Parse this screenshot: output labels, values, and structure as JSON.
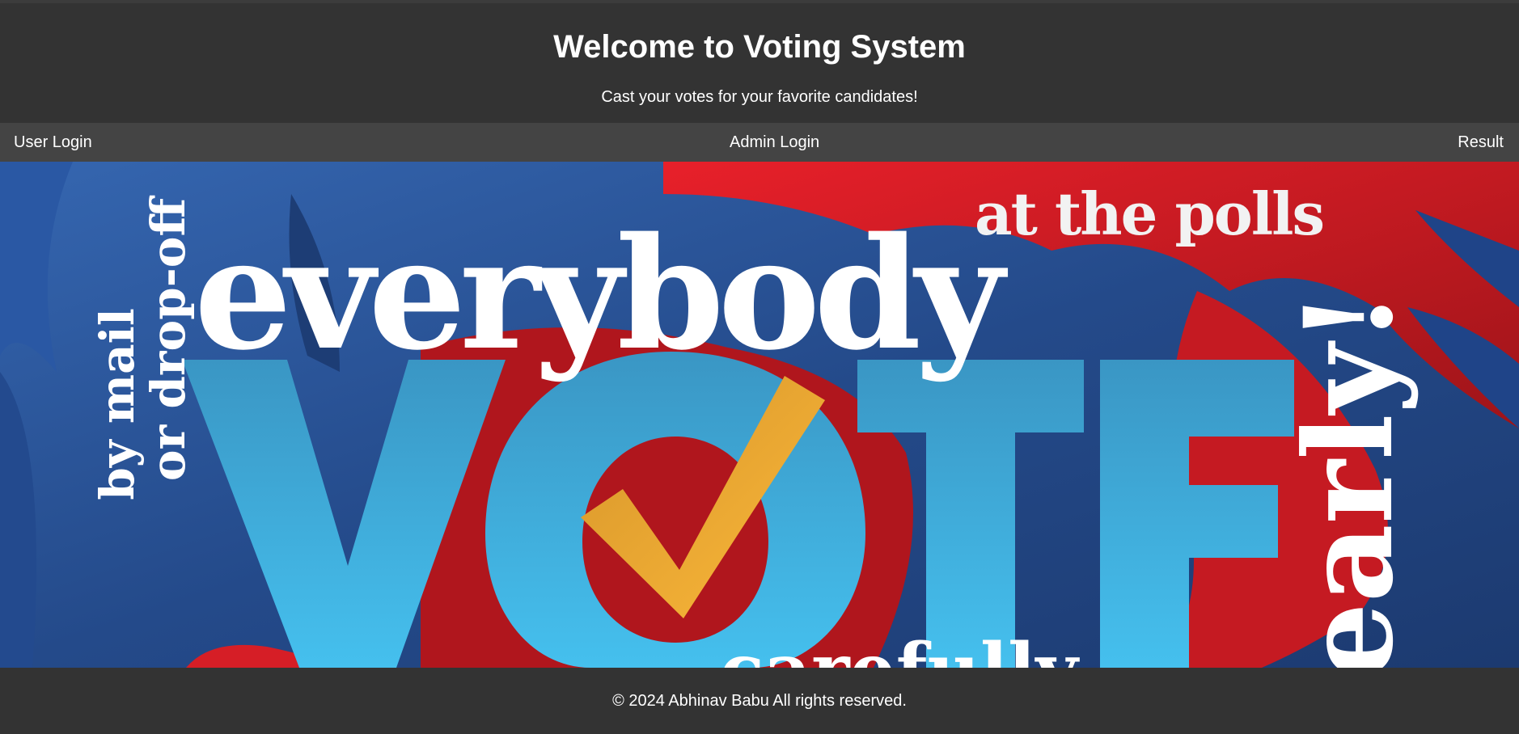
{
  "header": {
    "title": "Welcome to Voting System",
    "subtitle": "Cast your votes for your favorite candidates!"
  },
  "nav": {
    "user_login": "User Login",
    "admin_login": "Admin Login",
    "result": "Result"
  },
  "banner": {
    "words": {
      "everybody": "everybody",
      "at_the_polls": "at the polls",
      "by_mail": "by mail",
      "or_drop_off": "or drop-off",
      "vote": "VOTE",
      "early": "early!",
      "carefully": "carefully"
    }
  },
  "footer": {
    "copyright": "© 2024 Abhinav Babu All rights reserved."
  },
  "colors": {
    "header_bg": "#333333",
    "nav_bg": "#444444",
    "banner_blue": "#2c5aa0",
    "banner_red": "#e31e24",
    "vote_cyan": "#3fb8e6",
    "check_gold": "#f7b538"
  }
}
